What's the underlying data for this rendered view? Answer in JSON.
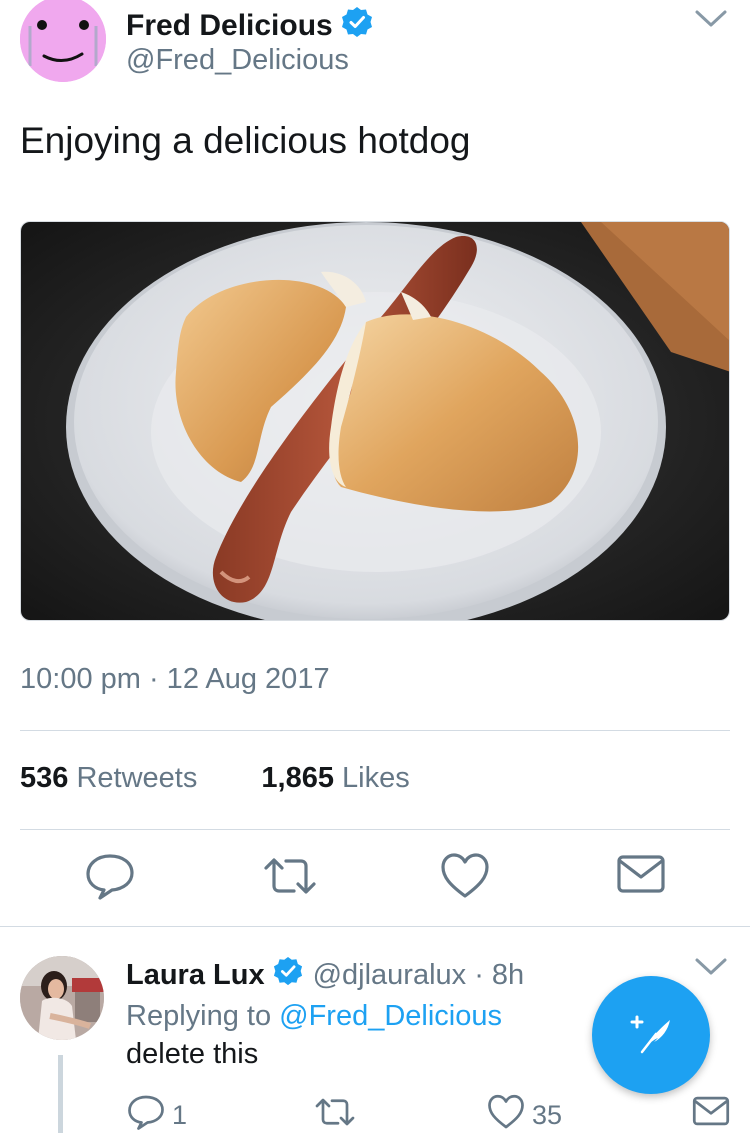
{
  "tweet": {
    "author_name": "Fred Delicious",
    "author_handle": "@Fred_Delicious",
    "text": "Enjoying a delicious hotdog",
    "timestamp": "10:00 pm · 12 Aug 2017",
    "retweets_count": "536",
    "retweets_label": "Retweets",
    "likes_count": "1,865",
    "likes_label": "Likes"
  },
  "reply": {
    "author_name": "Laura Lux",
    "author_handle": "@djlauralux · 8h",
    "replying_prefix": "Replying to",
    "replying_to": "@Fred_Delicious",
    "text": "delete this",
    "reply_count": "1",
    "like_count": "35"
  },
  "icons": {
    "verified": "verified-badge-icon",
    "caret": "chevron-down-icon",
    "reply": "reply-icon",
    "retweet": "retweet-icon",
    "like": "heart-icon",
    "share": "envelope-icon",
    "compose": "compose-feather-icon"
  },
  "colors": {
    "accent": "#1da1f2",
    "secondary_text": "#657786",
    "avatar_pink": "#f0a8ee"
  }
}
